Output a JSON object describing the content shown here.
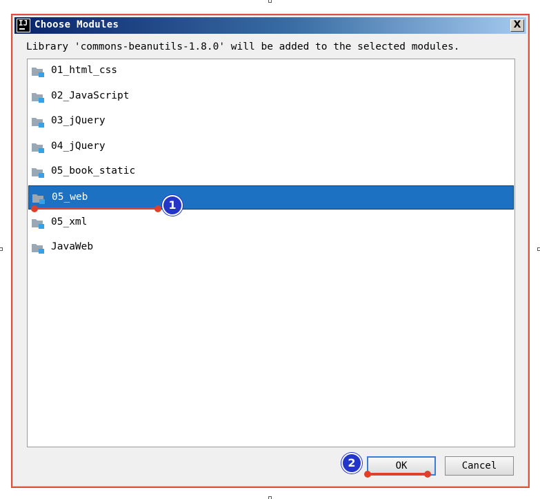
{
  "dialog": {
    "title": "Choose Modules",
    "app_icon_text": "IJ",
    "close_label": "X",
    "message": "Library 'commons-beanutils-1.8.0' will be added to the selected modules."
  },
  "modules": [
    {
      "label": "01_html_css",
      "selected": false
    },
    {
      "label": "02_JavaScript",
      "selected": false
    },
    {
      "label": "03_jQuery",
      "selected": false
    },
    {
      "label": "04_jQuery",
      "selected": false
    },
    {
      "label": "05_book_static",
      "selected": false
    },
    {
      "label": "05_web",
      "selected": true
    },
    {
      "label": "05_xml",
      "selected": false
    },
    {
      "label": "JavaWeb",
      "selected": false
    }
  ],
  "buttons": {
    "ok_label": "OK",
    "cancel_label": "Cancel"
  },
  "annotations": {
    "step1": "1",
    "step2": "2"
  },
  "colors": {
    "selection": "#1c71c3",
    "annotation_badge": "#2436c8",
    "annotation_line": "#e0402a",
    "dialog_border": "#e0503a"
  },
  "icons": {
    "module": "module-folder-icon",
    "app": "intellij-app-icon",
    "close": "close-icon"
  }
}
